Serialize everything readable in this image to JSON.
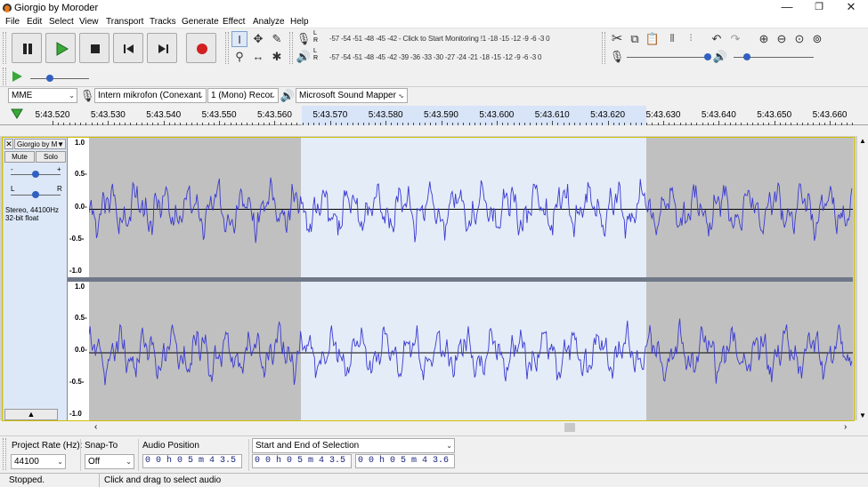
{
  "window": {
    "title": "Giorgio by Moroder",
    "minimize": "—",
    "restore": "❐",
    "close": "✕"
  },
  "menu": [
    "File",
    "Edit",
    "Select",
    "View",
    "Transport",
    "Tracks",
    "Generate",
    "Effect",
    "Analyze",
    "Help"
  ],
  "meters": {
    "record_scale": "-57 -54 -51 -48 -45 -42 -",
    "record_prompt": "Click to Start Monitoring",
    "record_scale_tail": "!1 -18 -15 -12  -9  -6  -3  0",
    "playback_scale": "-57 -54 -51 -48 -45 -42 -39 -36 -33 -30 -27 -24 -21 -18 -15 -12  -9  -6  -3  0",
    "channel_l": "L",
    "channel_r": "R"
  },
  "device": {
    "host": "MME",
    "input_device": "Intern mikrofon (Conexant",
    "channels": "1 (Mono) Recor",
    "output_device": "Microsoft Sound Mapper -"
  },
  "timeline": {
    "ticks": [
      "5:43.520",
      "5:43.530",
      "5:43.540",
      "5:43.550",
      "5:43.560",
      "5:43.570",
      "5:43.580",
      "5:43.590",
      "5:43.600",
      "5:43.610",
      "5:43.620",
      "5:43.630",
      "5:43.640",
      "5:43.650",
      "5:43.660"
    ]
  },
  "track": {
    "name": "Giorgio by M",
    "mute": "Mute",
    "solo": "Solo",
    "gain_minus": "-",
    "gain_plus": "+",
    "pan_left": "L",
    "pan_right": "R",
    "format": "Stereo, 44100Hz",
    "bitdepth": "32-bit float",
    "amp_labels": [
      "1.0",
      "0.5-",
      "0.0-",
      "-0.5-",
      "-1.0"
    ],
    "collapse": "▲"
  },
  "selection_toolbar": {
    "project_rate_label": "Project Rate (Hz):",
    "project_rate": "44100",
    "snap_to_label": "Snap-To",
    "snap_to": "Off",
    "audio_position_label": "Audio Position",
    "audio_position": "0 0 h 0 5 m 4 3.5 6 5 s",
    "selection_mode": "Start and End of Selection",
    "sel_start": "0 0 h 0 5 m 4 3.5 6 5 s",
    "sel_end": "0 0 h 0 5 m 4 3.6 2 7 s"
  },
  "status": {
    "state": "Stopped.",
    "hint": "Click and drag to select audio"
  },
  "colors": {
    "waveform": "#3a3ad0",
    "selection": "#ffffff",
    "unselected": "#c0c0c0",
    "record_red": "#d22020",
    "play_green": "#3aa83a"
  }
}
